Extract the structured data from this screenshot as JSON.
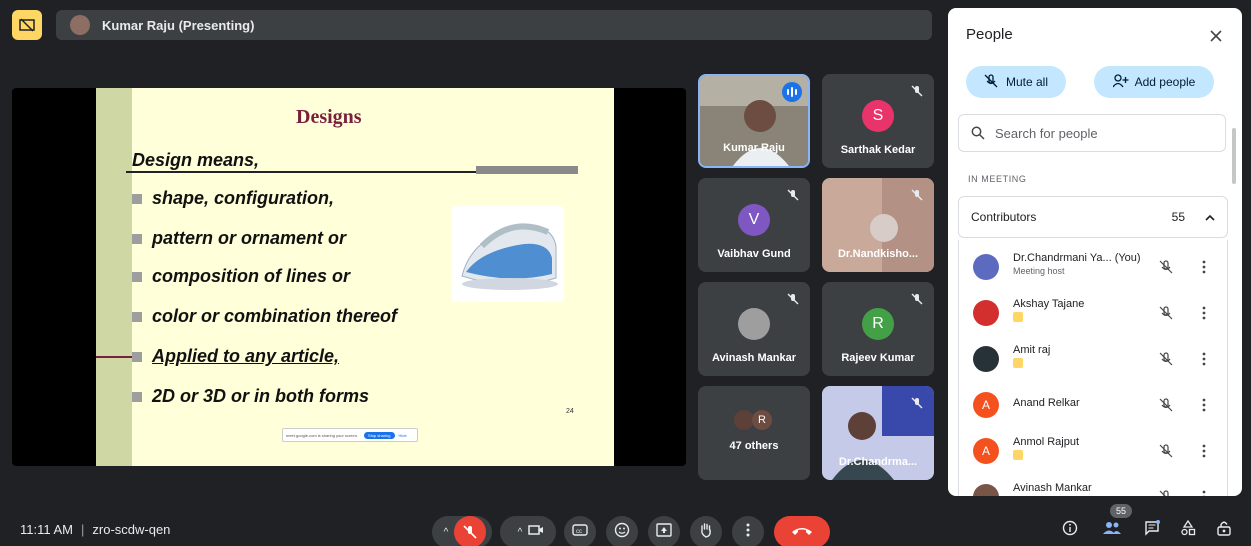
{
  "topbar": {
    "presenter_label": "Kumar Raju (Presenting)"
  },
  "slide": {
    "title": "Designs",
    "lead": "Design means,",
    "bullets": [
      "shape, configuration,",
      "pattern or ornament or",
      "composition of lines or",
      "color or combination thereof",
      "Applied to any article,",
      "2D or 3D or in both forms"
    ],
    "page_number": "24",
    "share_bar": {
      "message": "meet.google.com is sharing your screen.",
      "stop": "Stop sharing",
      "hide": "Hide"
    }
  },
  "tiles": [
    {
      "name": "Kumar Raju"
    },
    {
      "name": "Sarthak Kedar",
      "letter": "S",
      "color": "#e8346b"
    },
    {
      "name": "Vaibhav Gund",
      "letter": "V",
      "color": "#7e57c2"
    },
    {
      "name": "Dr.Nandkisho..."
    },
    {
      "name": "Avinash Mankar"
    },
    {
      "name": "Rajeev Kumar",
      "letter": "R",
      "color": "#43a047"
    },
    {
      "name": "47 others",
      "letter": "R"
    },
    {
      "name": "Dr.Chandrma..."
    }
  ],
  "bottom": {
    "time": "11:11 AM",
    "meeting_code": "zro-scdw-qen",
    "participant_count": "55"
  },
  "panel": {
    "title": "People",
    "mute_all": "Mute all",
    "add_people": "Add people",
    "search_placeholder": "Search for people",
    "section_label": "IN MEETING",
    "contributors_label": "Contributors",
    "contributors_count": "55",
    "people": [
      {
        "name": "Dr.Chandrmani Ya...  (You)",
        "sub": "Meeting host",
        "avatar_color": "#5c6bc0"
      },
      {
        "name": "Akshay Tajane",
        "avatar_color": "#d32f2f"
      },
      {
        "name": "Amit raj",
        "avatar_color": "#263238"
      },
      {
        "name": "Anand Relkar",
        "letter": "A",
        "avatar_color": "#f4511e"
      },
      {
        "name": "Anmol Rajput",
        "letter": "A",
        "avatar_color": "#f4511e"
      },
      {
        "name": "Avinash Mankar",
        "avatar_color": "#795548"
      }
    ]
  }
}
